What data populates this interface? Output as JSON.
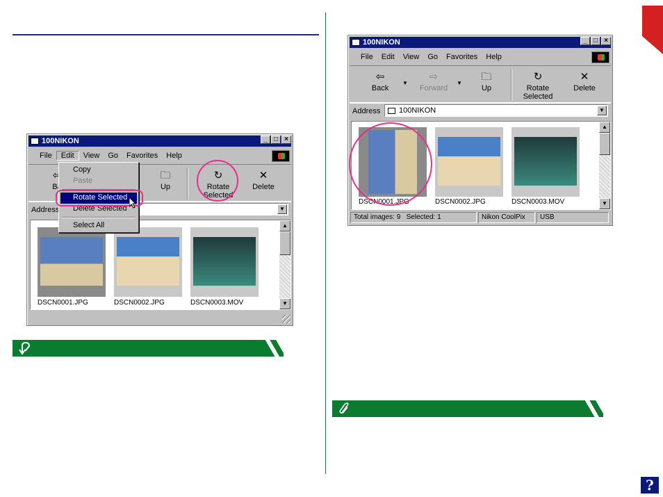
{
  "left_window": {
    "title": "100NIKON",
    "menu": [
      "File",
      "Edit",
      "View",
      "Go",
      "Favorites",
      "Help"
    ],
    "toolbar": {
      "back": "Ba",
      "up": "Up",
      "rotate_1": "Rotate",
      "rotate_2": "Selected",
      "delete": "Delete"
    },
    "address_label": "Address",
    "edit_menu": {
      "copy": "Copy",
      "paste": "Paste",
      "rotate": "Rotate Selected",
      "delete": "Delete Selected",
      "select_all": "Select All"
    },
    "files": [
      "DSCN0001.JPG",
      "DSCN0002.JPG",
      "DSCN0003.MOV"
    ]
  },
  "right_window": {
    "title": "100NIKON",
    "menu": [
      "File",
      "Edit",
      "View",
      "Go",
      "Favorites",
      "Help"
    ],
    "toolbar": {
      "back": "Back",
      "forward": "Forward",
      "up": "Up",
      "rotate_1": "Rotate",
      "rotate_2": "Selected",
      "delete": "Delete"
    },
    "address_label": "Address",
    "address_value": "100NIKON",
    "files": [
      "DSCN0001.JPG",
      "DSCN0002.JPG",
      "DSCN0003.MOV"
    ],
    "status": {
      "total": "Total images: 9",
      "selected": "Selected: 1",
      "camera": "Nikon CoolPix",
      "conn": "USB"
    }
  },
  "help_glyph": "?",
  "colors": {
    "title_bar": "#0a1a7a",
    "highlight": "#000080",
    "ring": "#e8308a",
    "banner": "#0b7b2f",
    "accent_red": "#d42020"
  }
}
